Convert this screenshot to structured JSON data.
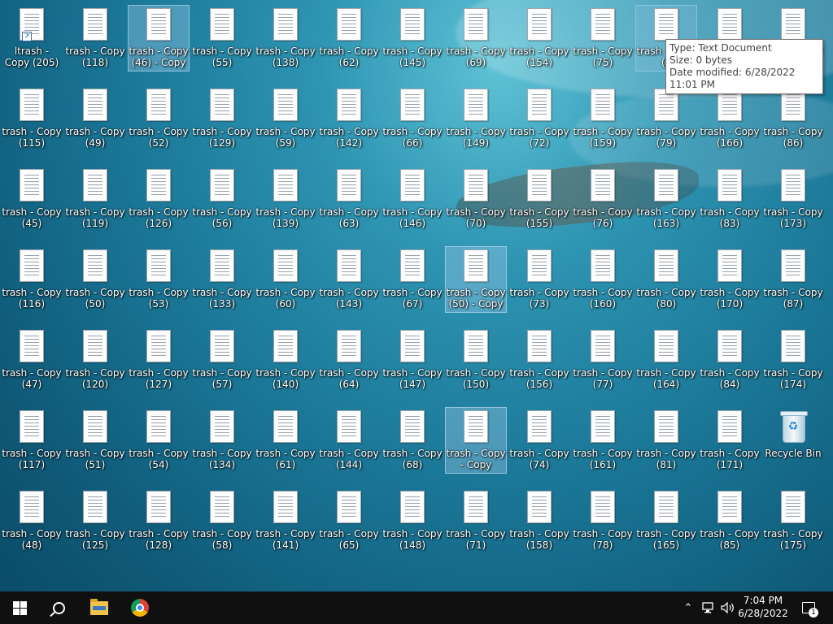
{
  "desktop": {
    "icons": [
      [
        "ltrash - Copy (205)",
        "trash - Copy (118)",
        "trash - Copy (46) - Copy",
        "trash - Copy (55)",
        "trash - Copy (138)",
        "trash - Copy (62)",
        "trash - Copy (145)",
        "trash - Copy (69)",
        "trash - Copy (154)",
        "trash - Copy (75)",
        "trash - Copy (1",
        "trash - Copy",
        "trash - Copy"
      ],
      [
        "trash - Copy (115)",
        "trash - Copy (49)",
        "trash - Copy (52)",
        "trash - Copy (129)",
        "trash - Copy (59)",
        "trash - Copy (142)",
        "trash - Copy (66)",
        "trash - Copy (149)",
        "trash - Copy (72)",
        "trash - Copy (159)",
        "trash - Copy (79)",
        "trash - Copy (166)",
        "trash - Copy (86)"
      ],
      [
        "trash - Copy (45)",
        "trash - Copy (119)",
        "trash - Copy (126)",
        "trash - Copy (56)",
        "trash - Copy (139)",
        "trash - Copy (63)",
        "trash - Copy (146)",
        "trash - Copy (70)",
        "trash - Copy (155)",
        "trash - Copy (76)",
        "trash - Copy (163)",
        "trash - Copy (83)",
        "trash - Copy (173)"
      ],
      [
        "trash - Copy (116)",
        "trash - Copy (50)",
        "trash - Copy (53)",
        "trash - Copy (133)",
        "trash - Copy (60)",
        "trash - Copy (143)",
        "trash - Copy (67)",
        "trash - Copy (50) - Copy",
        "trash - Copy (73)",
        "trash - Copy (160)",
        "trash - Copy (80)",
        "trash - Copy (170)",
        "trash - Copy (87)"
      ],
      [
        "trash - Copy (47)",
        "trash - Copy (120)",
        "trash - Copy (127)",
        "trash - Copy (57)",
        "trash - Copy (140)",
        "trash - Copy (64)",
        "trash - Copy (147)",
        "trash - Copy (150)",
        "trash - Copy (156)",
        "trash - Copy (77)",
        "trash - Copy (164)",
        "trash - Copy (84)",
        "trash - Copy (174)"
      ],
      [
        "trash - Copy (117)",
        "trash - Copy (51)",
        "trash - Copy (54)",
        "trash - Copy (134)",
        "trash - Copy (61)",
        "trash - Copy (144)",
        "trash - Copy (68)",
        "trash - Copy - Copy",
        "trash - Copy (74)",
        "trash - Copy (161)",
        "trash - Copy (81)",
        "trash - Copy (171)",
        "Recycle Bin"
      ],
      [
        "trash - Copy (48)",
        "trash - Copy (125)",
        "trash - Copy (128)",
        "trash - Copy (58)",
        "trash - Copy (141)",
        "trash - Copy (65)",
        "trash - Copy (148)",
        "trash - Copy (71)",
        "trash - Copy (158)",
        "trash - Copy (78)",
        "trash - Copy (165)",
        "trash - Copy (85)",
        "trash - Copy (175)"
      ]
    ],
    "selected": [
      "0-2",
      "3-7",
      "5-7"
    ],
    "hovered": [
      "0-10"
    ],
    "shortcut": [
      "0-0"
    ],
    "recycle_bin": "5-12"
  },
  "tooltip": {
    "type": "Type: Text Document",
    "size": "Size: 0 bytes",
    "date": "Date modified: 6/28/2022 11:01 PM"
  },
  "taskbar": {
    "icons": [
      "windows-start-icon",
      "search-icon",
      "file-explorer-icon",
      "chrome-icon"
    ],
    "tray_icons": [
      "chevron-up-icon",
      "network-icon",
      "volume-icon"
    ],
    "time": "7:04 PM",
    "date": "6/28/2022",
    "notification_count": "1"
  },
  "colors": {
    "taskbar": "#101010",
    "selection": "#aad2f0",
    "wallpaper": "#1a7595"
  }
}
